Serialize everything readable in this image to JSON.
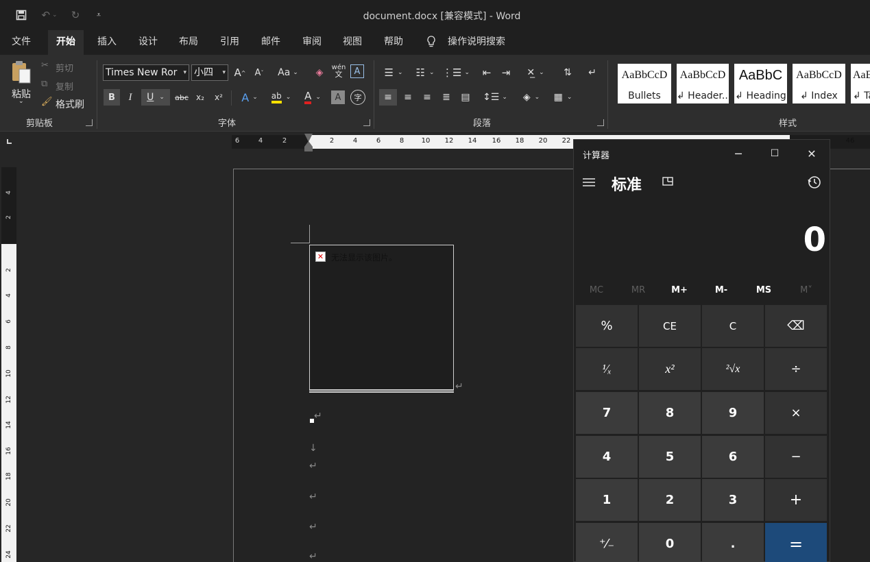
{
  "window_title": "document.docx [兼容模式]  -  Word",
  "tabs": [
    "文件",
    "开始",
    "插入",
    "设计",
    "布局",
    "引用",
    "邮件",
    "审阅",
    "视图",
    "帮助",
    "操作说明搜索"
  ],
  "active_tab": "开始",
  "clipboard": {
    "paste": "粘贴",
    "cut": "剪切",
    "copy": "复制",
    "format_painter": "格式刷",
    "label": "剪贴板"
  },
  "font": {
    "family": "Times New Ror",
    "size": "小四",
    "grow": "A",
    "shrink": "A",
    "case": "Aa",
    "phonetic": "wén",
    "bold": "B",
    "italic": "I",
    "underline": "U",
    "strike": "abc",
    "subscript": "x₂",
    "superscript": "x²",
    "label": "字体"
  },
  "paragraph": {
    "label": "段落"
  },
  "styles": {
    "label": "样式",
    "items": [
      {
        "sample": "AaBbCcD",
        "name": "Bullets"
      },
      {
        "sample": "AaBbCcD",
        "name": "↲ Header..."
      },
      {
        "sample": "AaBbC",
        "name": "↲ Heading"
      },
      {
        "sample": "AaBbCcD",
        "name": "↲ Index"
      },
      {
        "sample": "AaE",
        "name": "↲ Ta"
      }
    ]
  },
  "ruler": {
    "left_ticks": [
      "6",
      "4",
      "2"
    ],
    "ticks": [
      "2",
      "4",
      "6",
      "8",
      "10",
      "12",
      "14",
      "16",
      "18",
      "20",
      "22"
    ],
    "right_tick": "46",
    "v_dark_ticks": [
      "4",
      "2"
    ],
    "v_ticks": [
      "2",
      "4",
      "6",
      "8",
      "10",
      "12",
      "14",
      "16",
      "18",
      "20",
      "22",
      "24"
    ]
  },
  "document": {
    "broken_image_text": "无法显示该图片。"
  },
  "calculator": {
    "title": "计算器",
    "mode": "标准",
    "display": "0",
    "memory": [
      {
        "label": "MC",
        "enabled": false
      },
      {
        "label": "MR",
        "enabled": false
      },
      {
        "label": "M+",
        "enabled": true
      },
      {
        "label": "M-",
        "enabled": true
      },
      {
        "label": "MS",
        "enabled": true
      },
      {
        "label": "M˅",
        "enabled": false
      }
    ],
    "keys": [
      [
        "%",
        "CE",
        "C",
        "⌫"
      ],
      [
        "¹⁄ₓ",
        "x²",
        "²√x",
        "÷"
      ],
      [
        "7",
        "8",
        "9",
        "×"
      ],
      [
        "4",
        "5",
        "6",
        "−"
      ],
      [
        "1",
        "2",
        "3",
        "+"
      ],
      [
        "⁺⁄₋",
        "0",
        ".",
        "="
      ]
    ]
  },
  "colors": {
    "accent_equals": "#1d4a7a",
    "highlight_yellow": "#ffe000",
    "font_red": "#e02020"
  }
}
